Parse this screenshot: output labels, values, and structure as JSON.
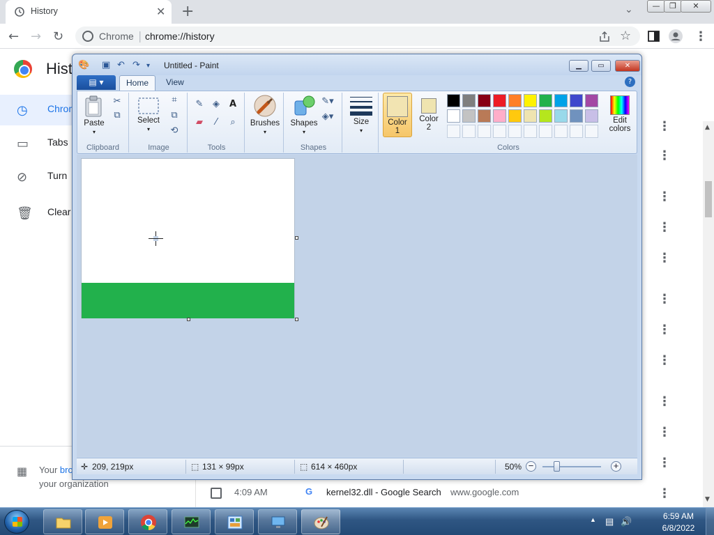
{
  "chrome": {
    "tab_title": "History",
    "tab_close": "✕",
    "new_tab": "+",
    "tab_menu": "⌄",
    "site_label": "Chrome",
    "url": "chrome://history",
    "window_minimize": "—",
    "window_restore": "❐",
    "window_close": "✕"
  },
  "history_page": {
    "title": "Hist",
    "nav": [
      {
        "label": "Chrom",
        "icon": "clock-icon"
      },
      {
        "label": "Tabs",
        "icon": "devices-icon"
      },
      {
        "label": "Turn",
        "icon": "sync-off-icon"
      },
      {
        "label": "Clear",
        "icon": "trash-icon"
      }
    ],
    "managed_line1_prefix": "Your ",
    "managed_line1_link": "bro",
    "managed_line2": "your organization",
    "row": {
      "time": "4:09 AM",
      "favicon": "G",
      "title": "kernel32.dll - Google Search",
      "domain": "www.google.com"
    },
    "kebab": "⋮"
  },
  "paint": {
    "title": "Untitled - Paint",
    "tabs": {
      "home": "Home",
      "view": "View"
    },
    "groups": {
      "clipboard": "Clipboard",
      "image": "Image",
      "tools": "Tools",
      "shapes": "Shapes",
      "colors": "Colors"
    },
    "buttons": {
      "paste": "Paste",
      "select": "Select",
      "brushes": "Brushes",
      "shapes": "Shapes",
      "size": "Size",
      "color1": "Color",
      "color1_num": "1",
      "color2": "Color",
      "color2_num": "2",
      "edit_colors_1": "Edit",
      "edit_colors_2": "colors"
    },
    "colors": {
      "color1": "#f2e4b2",
      "color2": "#efe4b0",
      "canvas_fill": "#22b14c",
      "palette_row1": [
        "#000000",
        "#7f7f7f",
        "#880015",
        "#ed1c24",
        "#ff7f27",
        "#fff200",
        "#22b14c",
        "#00a2e8",
        "#3f48cc",
        "#a349a4"
      ],
      "palette_row2": [
        "#ffffff",
        "#c3c3c3",
        "#b97a57",
        "#ffaec9",
        "#ffc90e",
        "#efe4b0",
        "#b5e61d",
        "#99d9ea",
        "#7092be",
        "#c8bfe7"
      ]
    },
    "status": {
      "cursor_pos": "209, 219px",
      "selection_size": "131 × 99px",
      "image_size": "614 × 460px",
      "zoom": "50%",
      "zoom_level": 0.5
    }
  },
  "taskbar": {
    "time": "6:59 AM",
    "date": "6/8/2022"
  }
}
